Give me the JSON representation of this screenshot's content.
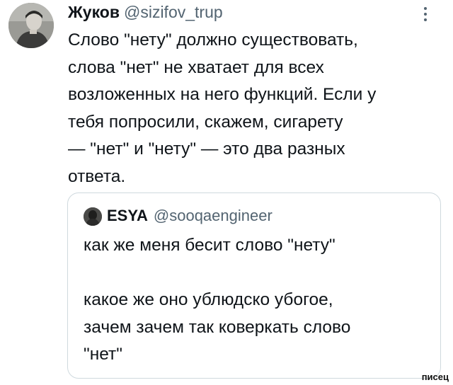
{
  "tweet": {
    "author_name": "Жуков",
    "author_handle": "@sizifov_trup",
    "text": "Слово \"нету\" должно существовать,\nслова \"нет\" не хватает для всех\nвозложенных на него функций. Если у\nтебя попросили, скажем, сигарету\n— \"нет\" и \"нету\" — это два разных\nответа.",
    "more_icon": "more-vertical-icon"
  },
  "quote": {
    "author_name": "ESYA",
    "author_handle": "@sooqaengineer",
    "text": "как же меня бесит слово \"нету\"\n\nкакое же оно ублюдско убогое,\nзачем зачем так коверкать слово\n\"нет\""
  },
  "watermark": "писец",
  "colors": {
    "text": "#0f1419",
    "secondary": "#536471",
    "border": "#cfd9de",
    "background": "#ffffff"
  }
}
